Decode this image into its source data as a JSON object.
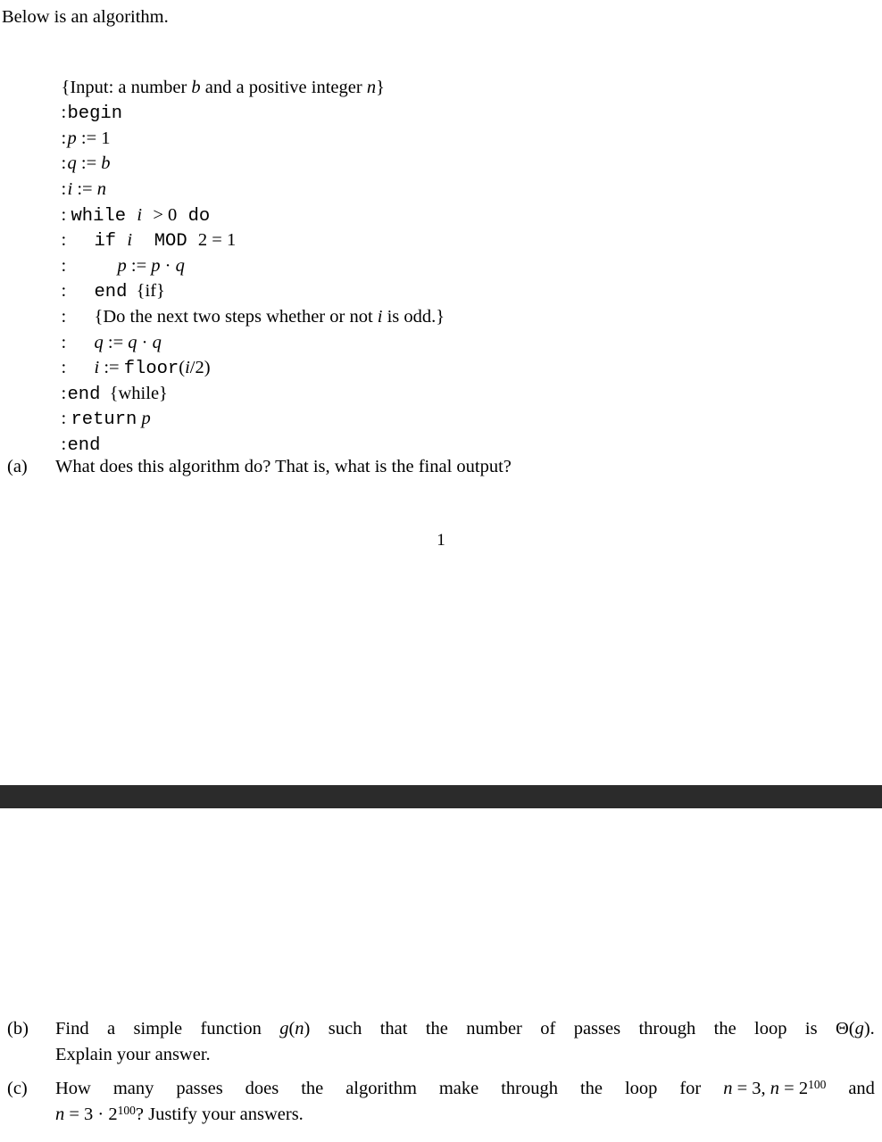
{
  "document": {
    "intro": "Below is an algorithm.",
    "page_number": "1",
    "separator_color": "#2b2b2b",
    "background_color": "#ffffff",
    "text_color": "#000000"
  },
  "algorithm": {
    "lines": [
      {
        "gutter": "",
        "indent": 0,
        "text": "{Input: a number b and a positive integer n}"
      },
      {
        "gutter": ":",
        "indent": 0,
        "text": "begin"
      },
      {
        "gutter": ":",
        "indent": 0,
        "text": "p := 1"
      },
      {
        "gutter": ":",
        "indent": 0,
        "text": "q := b"
      },
      {
        "gutter": ":",
        "indent": 0,
        "text": "i := n"
      },
      {
        "gutter": ":",
        "indent": 0,
        "text": "while i > 0 do"
      },
      {
        "gutter": ":",
        "indent": 1,
        "text": "if i  MOD 2 = 1"
      },
      {
        "gutter": ":",
        "indent": 2,
        "text": "p := p · q"
      },
      {
        "gutter": ":",
        "indent": 1,
        "text": "end  {if}"
      },
      {
        "gutter": ":",
        "indent": 1,
        "text": "{Do the next two steps whether or not i is odd.}"
      },
      {
        "gutter": ":",
        "indent": 1,
        "text": "q := q · q"
      },
      {
        "gutter": ":",
        "indent": 1,
        "text": "i := floor(i/2)"
      },
      {
        "gutter": ":",
        "indent": 0,
        "text": "end  {while}"
      },
      {
        "gutter": ":",
        "indent": 0,
        "text": "return p"
      },
      {
        "gutter": ":",
        "indent": 0,
        "text": "end"
      }
    ]
  },
  "questions": [
    {
      "label": "(a)",
      "lines": [
        "What does this algorithm do? That is, what is the final output?"
      ]
    },
    {
      "label": "(b)",
      "lines": [
        "Find a simple function g(n) such that the number of passes through the loop is Θ(g).",
        "Explain your answer."
      ]
    },
    {
      "label": "(c)",
      "lines": [
        "How many passes does the algorithm make through the loop for n = 3, n = 2^100 and",
        "n = 3 · 2^100? Justify your answers."
      ]
    }
  ]
}
